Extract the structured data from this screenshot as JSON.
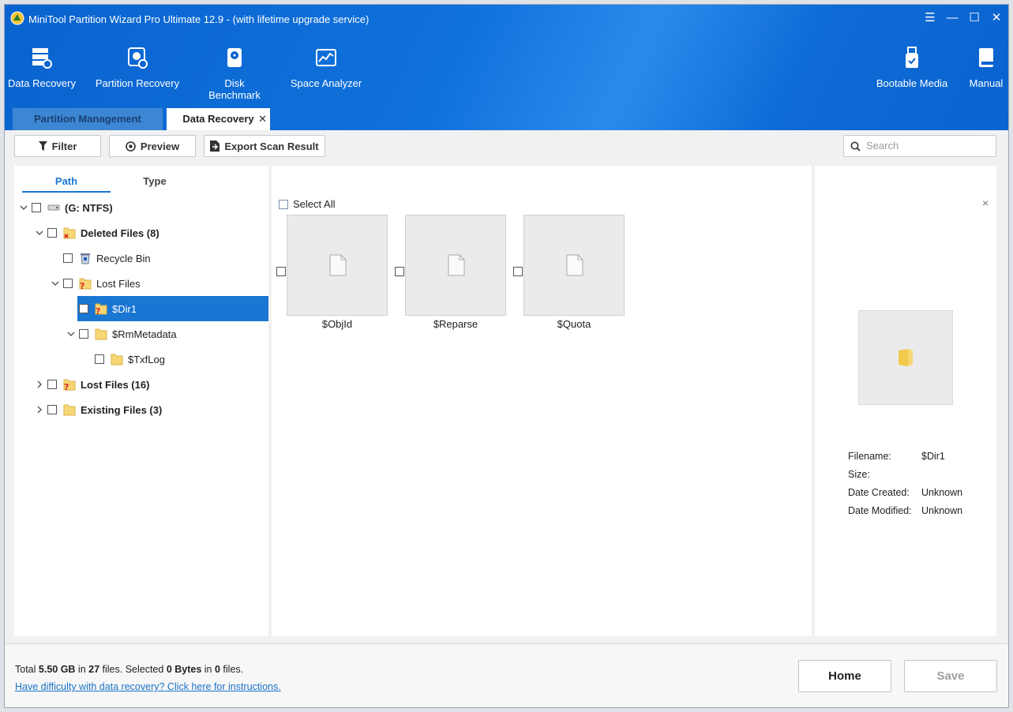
{
  "window": {
    "title": "MiniTool Partition Wizard Pro Ultimate 12.9 - (with lifetime upgrade service)",
    "controls": {
      "menu": "☰",
      "minimize": "—",
      "maximize": "☐",
      "close": "✕"
    }
  },
  "ribbon": {
    "tools": [
      {
        "label": "Data Recovery",
        "icon": "data-recovery-icon"
      },
      {
        "label": "Partition Recovery",
        "icon": "partition-recovery-icon"
      },
      {
        "label": "Disk Benchmark",
        "icon": "disk-benchmark-icon"
      },
      {
        "label": "Space Analyzer",
        "icon": "space-analyzer-icon"
      }
    ],
    "right_tools": [
      {
        "label": "Bootable Media",
        "icon": "usb-icon"
      },
      {
        "label": "Manual",
        "icon": "book-icon"
      }
    ]
  },
  "tabs": {
    "partition_management": "Partition Management",
    "data_recovery": "Data Recovery",
    "close_glyph": "✕"
  },
  "toolbar": {
    "filter": "Filter",
    "preview": "Preview",
    "export": "Export Scan Result",
    "search_placeholder": "Search"
  },
  "left": {
    "subtabs": {
      "path": "Path",
      "type": "Type",
      "active": "Path"
    },
    "tree": [
      {
        "label": "(G: NTFS)",
        "level": 0,
        "expanded": true,
        "bold": true,
        "icon": "drive-icon"
      },
      {
        "label": "Deleted Files (8)",
        "level": 1,
        "expanded": true,
        "bold": true,
        "icon": "deleted-folder-icon"
      },
      {
        "label": "Recycle Bin",
        "level": 2,
        "expanded": null,
        "bold": false,
        "icon": "recycle-bin-icon"
      },
      {
        "label": "Lost Files",
        "level": 2,
        "expanded": true,
        "bold": false,
        "icon": "lost-folder-icon"
      },
      {
        "label": "$Dir1",
        "level": 3,
        "expanded": null,
        "bold": false,
        "icon": "lost-folder-icon",
        "selected": true
      },
      {
        "label": "$RmMetadata",
        "level": 3,
        "expanded": true,
        "bold": false,
        "icon": "folder-icon"
      },
      {
        "label": "$TxfLog",
        "level": 4,
        "expanded": null,
        "bold": false,
        "icon": "folder-icon"
      },
      {
        "label": "Lost Files (16)",
        "level": 1,
        "expanded": false,
        "bold": true,
        "icon": "lost-folder-icon"
      },
      {
        "label": "Existing Files (3)",
        "level": 1,
        "expanded": false,
        "bold": true,
        "icon": "folder-icon"
      }
    ]
  },
  "middle": {
    "select_all": "Select All",
    "files": [
      {
        "name": "$ObjId"
      },
      {
        "name": "$Reparse"
      },
      {
        "name": "$Quota"
      }
    ]
  },
  "preview": {
    "close_glyph": "×",
    "filename_label": "Filename:",
    "filename_value": "$Dir1",
    "size_label": "Size:",
    "size_value": "",
    "created_label": "Date Created:",
    "created_value": "Unknown",
    "modified_label": "Date Modified:",
    "modified_value": "Unknown"
  },
  "footer": {
    "total_prefix": "Total ",
    "total_size": "5.50 GB",
    "in1": " in ",
    "total_files": "27",
    "files1": " files.  Selected ",
    "selected_size": "0 Bytes",
    "in2": " in ",
    "selected_files": "0",
    "files2": " files.",
    "help_link": "Have difficulty with data recovery? Click here for instructions.",
    "home": "Home",
    "save": "Save"
  },
  "colors": {
    "accent": "#1976d2",
    "ribbon": "#0a63cf"
  }
}
